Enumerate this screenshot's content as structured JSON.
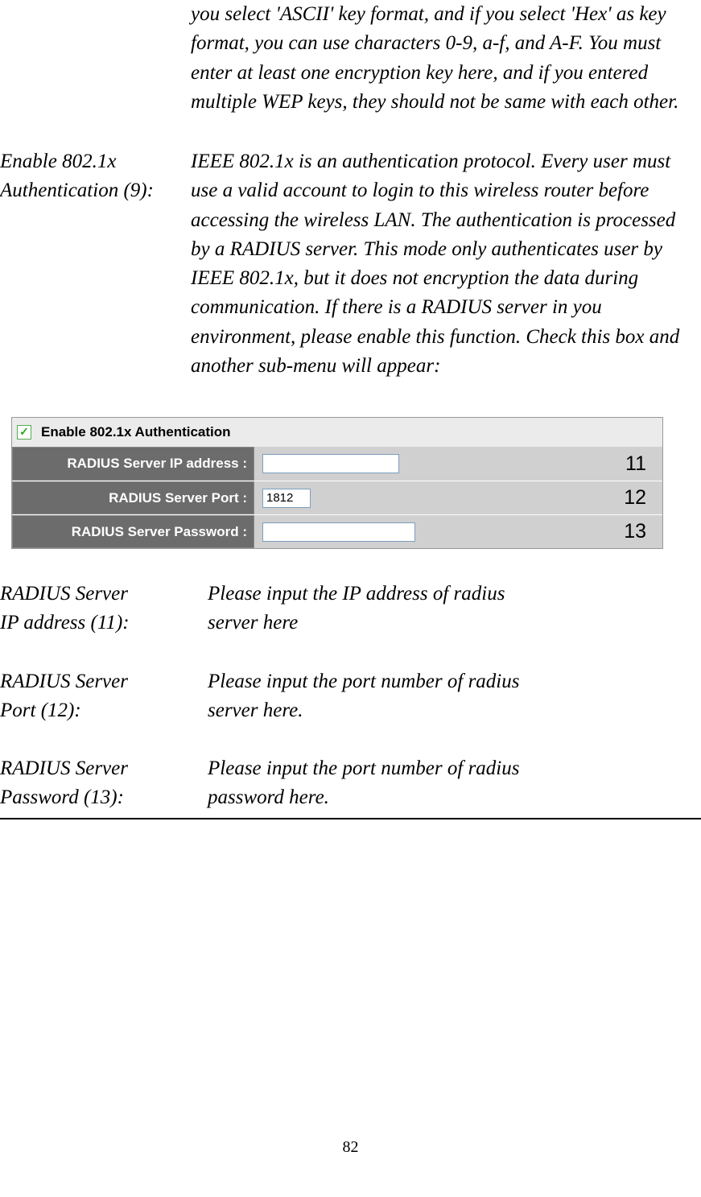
{
  "intro_paragraph": "you select 'ASCII' key format, and if you select 'Hex' as key format, you can use characters 0-9, a-f, and A-F. You must enter at least one encryption key here, and if you entered multiple WEP keys, they should not be same with each other.",
  "enable_8021x": {
    "term_line1": "Enable 802.1x",
    "term_line2": "Authentication (9):",
    "desc": "IEEE 802.1x is an authentication protocol. Every user must use a valid account to login to this wireless router before accessing the wireless LAN. The authentication is processed by a RADIUS server. This mode only authenticates user by IEEE 802.1x, but it does not encryption the data during communication. If there is a RADIUS server in you environment, please enable this function. Check this box and another sub-menu will appear:"
  },
  "screenshot": {
    "checkbox_checked": "✓",
    "header": "Enable 802.1x Authentication",
    "rows": [
      {
        "label": "RADIUS Server IP address :",
        "value": "",
        "annotation": "11",
        "input_class": "input-ip"
      },
      {
        "label": "RADIUS Server Port :",
        "value": "1812",
        "annotation": "12",
        "input_class": "input-port"
      },
      {
        "label": "RADIUS Server Password :",
        "value": "",
        "annotation": "13",
        "input_class": "input-pw"
      }
    ]
  },
  "definitions": [
    {
      "term_line1": "RADIUS Server",
      "term_line2": "IP address (11):",
      "desc_line1": "Please input the IP address of radius",
      "desc_line2": "server here"
    },
    {
      "term_line1": "RADIUS Server",
      "term_line2": "Port (12):",
      "desc_line1": "Please input the port number of radius",
      "desc_line2": "server here."
    },
    {
      "term_line1": "RADIUS Server",
      "term_line2": "Password (13):",
      "desc_line1": "Please input the port number of radius",
      "desc_line2": "password here."
    }
  ],
  "page_number": "82"
}
